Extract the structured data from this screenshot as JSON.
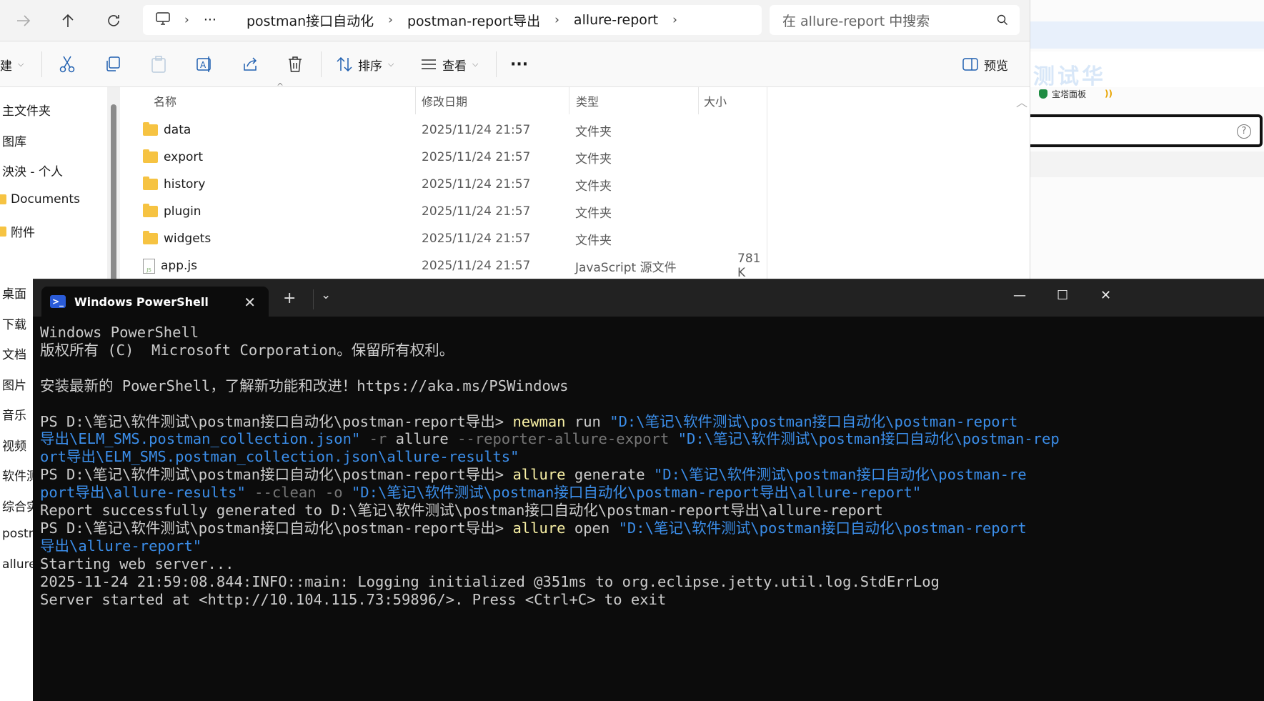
{
  "explorer": {
    "breadcrumb": [
      "postman接口自动化",
      "postman-report导出",
      "allure-report"
    ],
    "breadcrumb_more": "···",
    "search_placeholder": "在 allure-report 中搜索",
    "toolbar": {
      "new_label": "建",
      "sort_label": "排序",
      "view_label": "查看",
      "more_label": "···",
      "preview_label": "预览"
    },
    "sidebar": [
      "主文件夹",
      "图库",
      "泱泱 - 个人",
      "Documents",
      "附件",
      "桌面",
      "下载",
      "文档",
      "图片",
      "音乐",
      "视频",
      "软件测",
      "综合实",
      "postm",
      "allure"
    ],
    "columns": {
      "name": "名称",
      "date": "修改日期",
      "type": "类型",
      "size": "大小"
    },
    "files": [
      {
        "name": "data",
        "date": "2025/11/24 21:57",
        "type": "文件夹",
        "size": ""
      },
      {
        "name": "export",
        "date": "2025/11/24 21:57",
        "type": "文件夹",
        "size": ""
      },
      {
        "name": "history",
        "date": "2025/11/24 21:57",
        "type": "文件夹",
        "size": ""
      },
      {
        "name": "plugin",
        "date": "2025/11/24 21:57",
        "type": "文件夹",
        "size": ""
      },
      {
        "name": "widgets",
        "date": "2025/11/24 21:57",
        "type": "文件夹",
        "size": ""
      },
      {
        "name": "app.js",
        "date": "2025/11/24 21:57",
        "type": "JavaScript 源文件",
        "size": "781 K"
      }
    ]
  },
  "browser": {
    "banner_text": "测试华",
    "bookmark": "宝塔面板"
  },
  "powershell": {
    "tab_title": "Windows PowerShell",
    "new_tab": "+",
    "lines": [
      "Windows PowerShell",
      "版权所有 (C)  Microsoft Corporation。保留所有权利。",
      "",
      "安装最新的 PowerShell，了解新功能和改进！https://aka.ms/PSWindows",
      "",
      "PS D:\\笔记\\软件测试\\postman接口自动化\\postman-report导出> ",
      "newman",
      " run ",
      "\"D:\\笔记\\软件测试\\postman接口自动化\\postman-report",
      "导出\\ELM_SMS.postman_collection.json\"",
      " -r ",
      "allure",
      " --reporter-allure-export ",
      "\"D:\\笔记\\软件测试\\postman接口自动化\\postman-rep",
      "ort导出\\ELM_SMS.postman_collection.json\\allure-results\"",
      "PS D:\\笔记\\软件测试\\postman接口自动化\\postman-report导出> ",
      "allure",
      " generate ",
      "\"D:\\笔记\\软件测试\\postman接口自动化\\postman-re",
      "port导出\\allure-results\"",
      " --clean -o ",
      "\"D:\\笔记\\软件测试\\postman接口自动化\\postman-report导出\\allure-report\"",
      "Report successfully generated to D:\\笔记\\软件测试\\postman接口自动化\\postman-report导出\\allure-report",
      "PS D:\\笔记\\软件测试\\postman接口自动化\\postman-report导出> ",
      "allure",
      " open ",
      "\"D:\\笔记\\软件测试\\postman接口自动化\\postman-report",
      "导出\\allure-report\"",
      "Starting web server...",
      "2025-11-24 21:59:08.844:INFO::main: Logging initialized @351ms to org.eclipse.jetty.util.log.StdErrLog",
      "Server started at <http://10.104.115.73:59896/>. Press <Ctrl+C> to exit"
    ]
  }
}
